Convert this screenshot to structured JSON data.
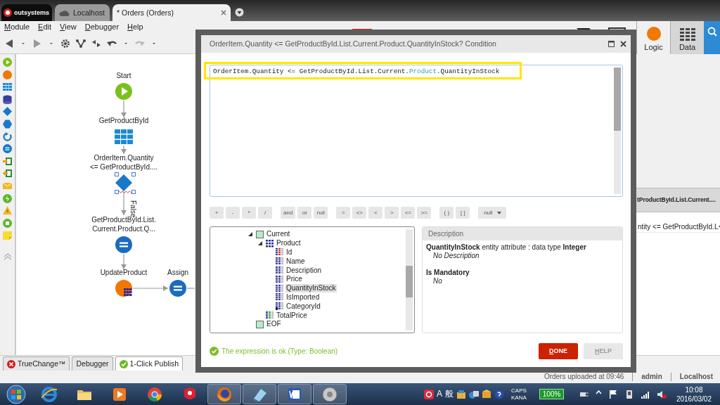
{
  "app_tabs": [
    {
      "kind": "brand",
      "label": "outsystems",
      "selected": false
    },
    {
      "kind": "server",
      "label": "Localhost",
      "selected": false
    },
    {
      "kind": "module",
      "label": "* Orders (Orders)",
      "selected": true
    }
  ],
  "menu": [
    "Module",
    "Edit",
    "View",
    "Debugger",
    "Help"
  ],
  "side_tabs": [
    {
      "kind": "logic",
      "label": "Logic",
      "selected": true
    },
    {
      "kind": "data",
      "label": "Data",
      "selected": false
    }
  ],
  "flow": {
    "nodes": [
      {
        "kind": "start",
        "lines": [
          "Start"
        ],
        "selected": false
      },
      {
        "kind": "aggregate",
        "lines": [
          "GetProductById"
        ],
        "selected": false
      },
      {
        "kind": "if",
        "lines": [
          "OrderItem.Quantity",
          "<= GetProductById...."
        ],
        "selected": true
      },
      {
        "kind": "assign",
        "lines": [
          "GetProductById.List.",
          "Current.Product.Q..."
        ],
        "selected": false
      },
      {
        "kind": "update",
        "lines": [
          "UpdateProduct"
        ],
        "selected": false
      },
      {
        "kind": "assign",
        "lines": [
          "Assign"
        ],
        "selected": false
      }
    ],
    "branch_label": "False"
  },
  "dialog": {
    "title": "OrderItem.Quantity <= GetProductById.List.Current.Product.QuantityInStock? Condition",
    "expression": [
      {
        "kind": "plain",
        "text": "OrderItem.Quantity <= GetProductById.List.Current."
      },
      {
        "kind": "entity",
        "text": "Product"
      },
      {
        "kind": "plain",
        "text": ".QuantityInStock"
      }
    ],
    "operator_groups": [
      [
        "+",
        "-",
        "*",
        "/"
      ],
      [
        "and",
        "or",
        "not"
      ],
      [
        "=",
        "<>",
        "<",
        ">",
        "<=",
        ">="
      ],
      [
        "( )",
        "[ ]"
      ]
    ],
    "null_menu": "null",
    "tree": [
      {
        "label": "Current",
        "kind": "record",
        "expanded": true,
        "selected": false,
        "children": [
          {
            "label": "Product",
            "kind": "entity",
            "expanded": true,
            "selected": false,
            "children": [
              {
                "label": "Id",
                "kind": "key",
                "selected": false
              },
              {
                "label": "Name",
                "kind": "attribute",
                "selected": false
              },
              {
                "label": "Description",
                "kind": "attribute",
                "selected": false
              },
              {
                "label": "Price",
                "kind": "attribute",
                "selected": false
              },
              {
                "label": "QuantityInStock",
                "kind": "attribute",
                "selected": true
              },
              {
                "label": "IsImported",
                "kind": "attribute",
                "selected": false
              },
              {
                "label": "CategoryId",
                "kind": "foreign_key",
                "selected": false
              }
            ]
          },
          {
            "label": "TotalPrice",
            "kind": "calculated",
            "selected": false
          }
        ]
      },
      {
        "label": "EOF",
        "kind": "record",
        "selected": false
      }
    ],
    "description": {
      "header": "Description",
      "summary": "**QuantityInStock** entity attribute : data type **Integer**",
      "detail": "No Description",
      "mandatory_label": "Is Mandatory",
      "mandatory_value": "No"
    },
    "validation": "The expression is ok (Type: Boolean)",
    "buttons": [
      {
        "kind": "primary",
        "label": "DONE"
      },
      {
        "kind": "secondary",
        "label": "HELP"
      }
    ]
  },
  "right_panel": {
    "header": "tProductById.List.Current....",
    "field": "ntity <= GetProductById.L"
  },
  "bottom_tabs": [
    {
      "kind": "error",
      "label": "TrueChange™",
      "selected": false
    },
    {
      "kind": "plain",
      "label": "Debugger",
      "selected": false
    },
    {
      "kind": "ok",
      "label": "1-Click Publish",
      "selected": true
    }
  ],
  "status_bar": {
    "message": "Orders uploaded at 09:46",
    "user": "admin",
    "server": "Localhost"
  },
  "taskbar": {
    "apps": [
      {
        "kind": "ie",
        "running": false
      },
      {
        "kind": "folder",
        "running": false
      },
      {
        "kind": "media",
        "running": false
      },
      {
        "kind": "chrome",
        "running": false
      },
      {
        "kind": "tool",
        "running": false
      },
      {
        "kind": "firefox",
        "running": true
      },
      {
        "kind": "paint",
        "running": true
      },
      {
        "kind": "word",
        "running": true
      },
      {
        "kind": "disc",
        "running": true
      }
    ],
    "ime": [
      "A",
      "般"
    ],
    "caps": "CAPS",
    "kana": "KANA",
    "battery": "100%",
    "time": "10:08",
    "date": "2016/03/02"
  }
}
